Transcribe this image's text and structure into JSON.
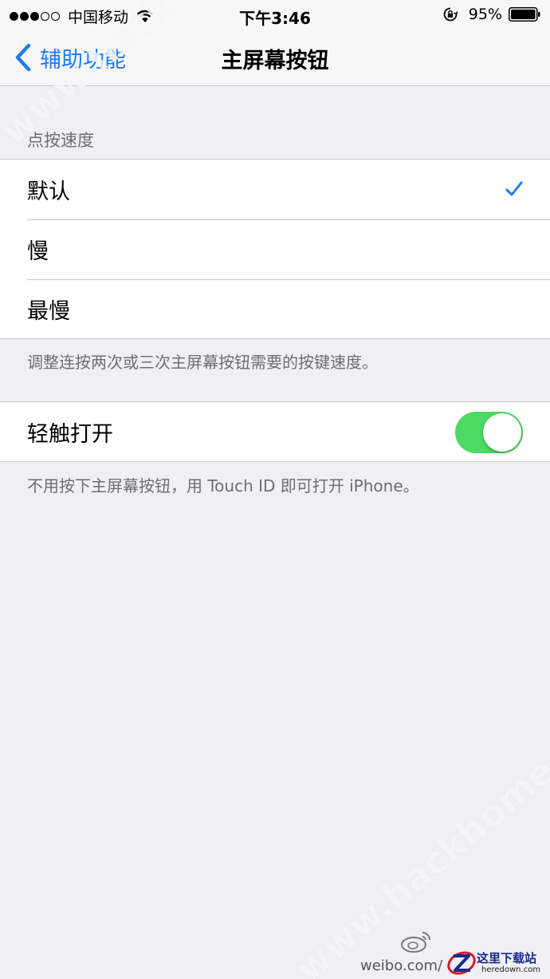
{
  "status_bar": {
    "carrier": "中国移动",
    "time": "下午3:46",
    "battery": "95%"
  },
  "nav": {
    "back_label": "辅助功能",
    "title": "主屏幕按钮"
  },
  "click_speed": {
    "header": "点按速度",
    "options": [
      {
        "label": "默认",
        "selected": true
      },
      {
        "label": "慢",
        "selected": false
      },
      {
        "label": "最慢",
        "selected": false
      }
    ],
    "footer": "调整连按两次或三次主屏幕按钮需要的按键速度。"
  },
  "rest_finger": {
    "label": "轻触打开",
    "enabled": true,
    "footer": "不用按下主屏幕按钮，用 Touch ID 即可打开 iPhone。"
  },
  "watermark": {
    "site": "www.hackhome.com",
    "credit": "weibo.com/",
    "logo_name": "这里下载站",
    "logo_url": "heredown.com"
  },
  "colors": {
    "accent": "#1a7cf2",
    "toggle_on": "#4cd964",
    "background": "#efeff4"
  }
}
